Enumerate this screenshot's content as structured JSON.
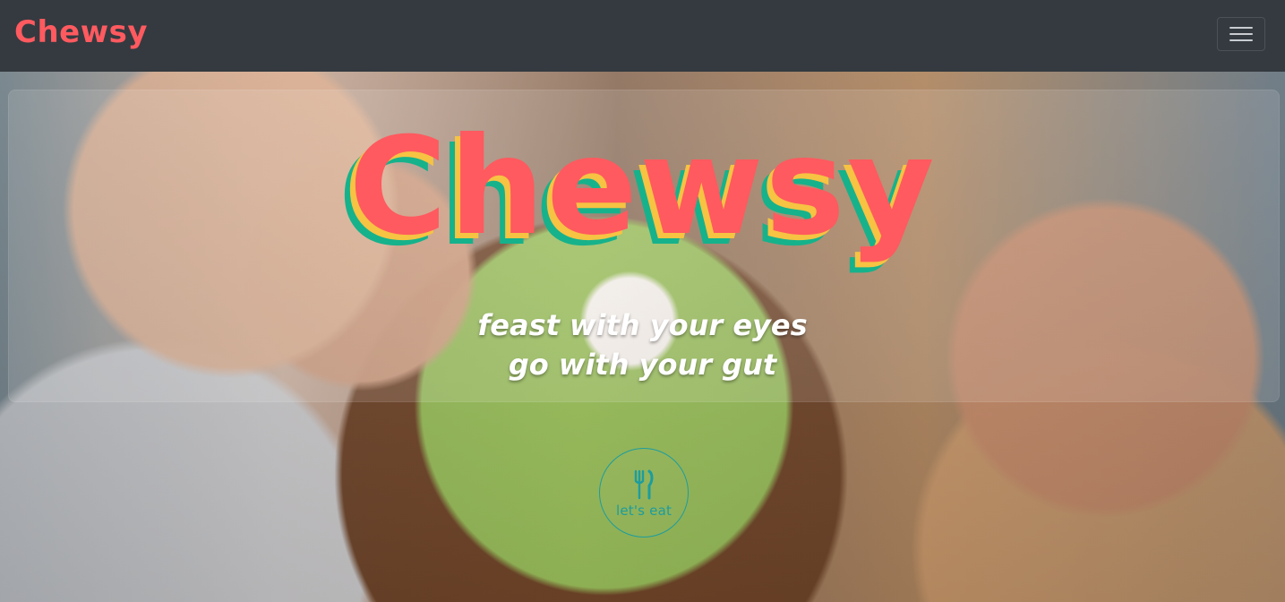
{
  "navbar": {
    "brand": "Chewsy",
    "menu_icon": "hamburger-icon"
  },
  "hero": {
    "title": "Chewsy",
    "tagline_line_1": "feast with your eyes",
    "tagline_line_2": "go with your gut",
    "cta": {
      "label": "let's eat",
      "icon": "fork-knife-icon"
    }
  },
  "colors": {
    "navbar_background": "#343a40",
    "brand": "#ff5a5f",
    "title_shadow_yellow": "#f6c342",
    "title_shadow_green": "#16b28b",
    "cta": "#1c9d9e"
  }
}
